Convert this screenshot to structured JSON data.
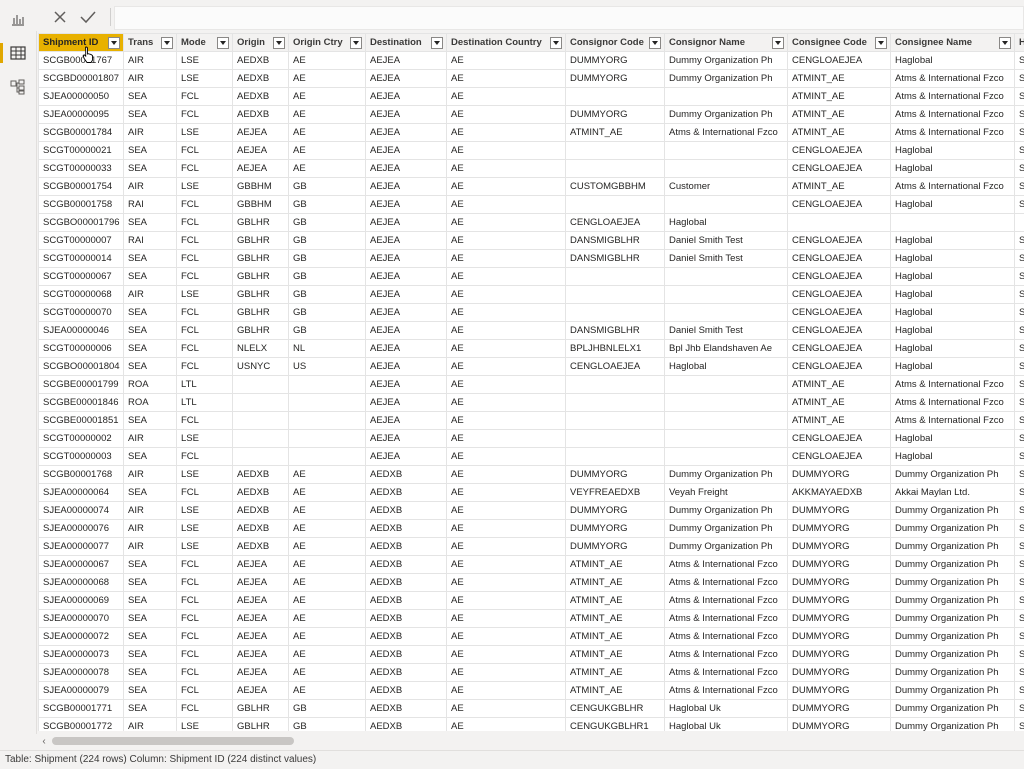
{
  "window": {
    "title": "Power BI Desktop - Data view"
  },
  "sidebar": {
    "items": [
      {
        "name": "report-view",
        "icon": "bar-chart-icon"
      },
      {
        "name": "data-view",
        "icon": "table-icon",
        "active": true
      },
      {
        "name": "model-view",
        "icon": "model-icon"
      }
    ]
  },
  "formula_bar": {
    "cancel_icon": "close-icon",
    "commit_icon": "check-icon",
    "value": ""
  },
  "table": {
    "columns": [
      "Shipment ID",
      "Trans",
      "Mode",
      "Origin",
      "Origin Ctry",
      "Destination",
      "Destination Country",
      "Consignor Code",
      "Consignor Name",
      "Consignee Code",
      "Consignee Name",
      "H"
    ],
    "selected_column": 0,
    "rows": [
      [
        "SCGB00001767",
        "AIR",
        "LSE",
        "AEDXB",
        "AE",
        "AEJEA",
        "AE",
        "DUMMYORG",
        "Dummy Organization Ph",
        "CENGLOAEJEA",
        "Haglobal",
        "SC"
      ],
      [
        "SCGBD00001807",
        "AIR",
        "LSE",
        "AEDXB",
        "AE",
        "AEJEA",
        "AE",
        "DUMMYORG",
        "Dummy Organization Ph",
        "ATMINT_AE",
        "Atms & International Fzco",
        "SC"
      ],
      [
        "SJEA00000050",
        "SEA",
        "FCL",
        "AEDXB",
        "AE",
        "AEJEA",
        "AE",
        "",
        "",
        "ATMINT_AE",
        "Atms & International Fzco",
        "SJ"
      ],
      [
        "SJEA00000095",
        "SEA",
        "FCL",
        "AEDXB",
        "AE",
        "AEJEA",
        "AE",
        "DUMMYORG",
        "Dummy Organization Ph",
        "ATMINT_AE",
        "Atms & International Fzco",
        "SJ"
      ],
      [
        "SCGB00001784",
        "AIR",
        "LSE",
        "AEJEA",
        "AE",
        "AEJEA",
        "AE",
        "ATMINT_AE",
        "Atms & International Fzco",
        "ATMINT_AE",
        "Atms & International Fzco",
        "SC"
      ],
      [
        "SCGT00000021",
        "SEA",
        "FCL",
        "AEJEA",
        "AE",
        "AEJEA",
        "AE",
        "",
        "",
        "CENGLOAEJEA",
        "Haglobal",
        "SC"
      ],
      [
        "SCGT00000033",
        "SEA",
        "FCL",
        "AEJEA",
        "AE",
        "AEJEA",
        "AE",
        "",
        "",
        "CENGLOAEJEA",
        "Haglobal",
        "SC"
      ],
      [
        "SCGB00001754",
        "AIR",
        "LSE",
        "GBBHM",
        "GB",
        "AEJEA",
        "AE",
        "CUSTOMGBBHM",
        "Customer",
        "ATMINT_AE",
        "Atms & International Fzco",
        "SC"
      ],
      [
        "SCGB00001758",
        "RAI",
        "FCL",
        "GBBHM",
        "GB",
        "AEJEA",
        "AE",
        "",
        "",
        "CENGLOAEJEA",
        "Haglobal",
        "SC"
      ],
      [
        "SCGBO00001796",
        "SEA",
        "FCL",
        "GBLHR",
        "GB",
        "AEJEA",
        "AE",
        "CENGLOAEJEA",
        "Haglobal",
        "",
        "",
        ""
      ],
      [
        "SCGT00000007",
        "RAI",
        "FCL",
        "GBLHR",
        "GB",
        "AEJEA",
        "AE",
        "DANSMIGBLHR",
        "Daniel Smith Test",
        "CENGLOAEJEA",
        "Haglobal",
        "SC"
      ],
      [
        "SCGT00000014",
        "SEA",
        "FCL",
        "GBLHR",
        "GB",
        "AEJEA",
        "AE",
        "DANSMIGBLHR",
        "Daniel Smith Test",
        "CENGLOAEJEA",
        "Haglobal",
        "SC"
      ],
      [
        "SCGT00000067",
        "SEA",
        "FCL",
        "GBLHR",
        "GB",
        "AEJEA",
        "AE",
        "",
        "",
        "CENGLOAEJEA",
        "Haglobal",
        "SC"
      ],
      [
        "SCGT00000068",
        "AIR",
        "LSE",
        "GBLHR",
        "GB",
        "AEJEA",
        "AE",
        "",
        "",
        "CENGLOAEJEA",
        "Haglobal",
        "SC"
      ],
      [
        "SCGT00000070",
        "SEA",
        "FCL",
        "GBLHR",
        "GB",
        "AEJEA",
        "AE",
        "",
        "",
        "CENGLOAEJEA",
        "Haglobal",
        "SC"
      ],
      [
        "SJEA00000046",
        "SEA",
        "FCL",
        "GBLHR",
        "GB",
        "AEJEA",
        "AE",
        "DANSMIGBLHR",
        "Daniel Smith Test",
        "CENGLOAEJEA",
        "Haglobal",
        "SJ"
      ],
      [
        "SCGT00000006",
        "SEA",
        "FCL",
        "NLELX",
        "NL",
        "AEJEA",
        "AE",
        "BPLJHBNLELX1",
        "Bpl Jhb Elandshaven Ae",
        "CENGLOAEJEA",
        "Haglobal",
        "SC"
      ],
      [
        "SCGBO00001804",
        "SEA",
        "FCL",
        "USNYC",
        "US",
        "AEJEA",
        "AE",
        "CENGLOAEJEA",
        "Haglobal",
        "CENGLOAEJEA",
        "Haglobal",
        "SC"
      ],
      [
        "SCGBE00001799",
        "ROA",
        "LTL",
        "",
        "",
        "AEJEA",
        "AE",
        "",
        "",
        "ATMINT_AE",
        "Atms & International Fzco",
        "SC"
      ],
      [
        "SCGBE00001846",
        "ROA",
        "LTL",
        "",
        "",
        "AEJEA",
        "AE",
        "",
        "",
        "ATMINT_AE",
        "Atms & International Fzco",
        "SC"
      ],
      [
        "SCGBE00001851",
        "SEA",
        "FCL",
        "",
        "",
        "AEJEA",
        "AE",
        "",
        "",
        "ATMINT_AE",
        "Atms & International Fzco",
        "SC"
      ],
      [
        "SCGT00000002",
        "AIR",
        "LSE",
        "",
        "",
        "AEJEA",
        "AE",
        "",
        "",
        "CENGLOAEJEA",
        "Haglobal",
        "SC"
      ],
      [
        "SCGT00000003",
        "SEA",
        "FCL",
        "",
        "",
        "AEJEA",
        "AE",
        "",
        "",
        "CENGLOAEJEA",
        "Haglobal",
        "SC"
      ],
      [
        "SCGB00001768",
        "AIR",
        "LSE",
        "AEDXB",
        "AE",
        "AEDXB",
        "AE",
        "DUMMYORG",
        "Dummy Organization Ph",
        "DUMMYORG",
        "Dummy Organization Ph",
        "SC"
      ],
      [
        "SJEA00000064",
        "SEA",
        "FCL",
        "AEDXB",
        "AE",
        "AEDXB",
        "AE",
        "VEYFREAEDXB",
        "Veyah Freight",
        "AKKMAYAEDXB",
        "Akkai Maylan Ltd.",
        "SJ"
      ],
      [
        "SJEA00000074",
        "AIR",
        "LSE",
        "AEDXB",
        "AE",
        "AEDXB",
        "AE",
        "DUMMYORG",
        "Dummy Organization Ph",
        "DUMMYORG",
        "Dummy Organization Ph",
        "SJ"
      ],
      [
        "SJEA00000076",
        "AIR",
        "LSE",
        "AEDXB",
        "AE",
        "AEDXB",
        "AE",
        "DUMMYORG",
        "Dummy Organization Ph",
        "DUMMYORG",
        "Dummy Organization Ph",
        "SJ"
      ],
      [
        "SJEA00000077",
        "AIR",
        "LSE",
        "AEDXB",
        "AE",
        "AEDXB",
        "AE",
        "DUMMYORG",
        "Dummy Organization Ph",
        "DUMMYORG",
        "Dummy Organization Ph",
        "SJ"
      ],
      [
        "SJEA00000067",
        "SEA",
        "FCL",
        "AEJEA",
        "AE",
        "AEDXB",
        "AE",
        "ATMINT_AE",
        "Atms & International Fzco",
        "DUMMYORG",
        "Dummy Organization Ph",
        "SJ"
      ],
      [
        "SJEA00000068",
        "SEA",
        "FCL",
        "AEJEA",
        "AE",
        "AEDXB",
        "AE",
        "ATMINT_AE",
        "Atms & International Fzco",
        "DUMMYORG",
        "Dummy Organization Ph",
        "SJ"
      ],
      [
        "SJEA00000069",
        "SEA",
        "FCL",
        "AEJEA",
        "AE",
        "AEDXB",
        "AE",
        "ATMINT_AE",
        "Atms & International Fzco",
        "DUMMYORG",
        "Dummy Organization Ph",
        "SJ"
      ],
      [
        "SJEA00000070",
        "SEA",
        "FCL",
        "AEJEA",
        "AE",
        "AEDXB",
        "AE",
        "ATMINT_AE",
        "Atms & International Fzco",
        "DUMMYORG",
        "Dummy Organization Ph",
        "SJ"
      ],
      [
        "SJEA00000072",
        "SEA",
        "FCL",
        "AEJEA",
        "AE",
        "AEDXB",
        "AE",
        "ATMINT_AE",
        "Atms & International Fzco",
        "DUMMYORG",
        "Dummy Organization Ph",
        "SJ"
      ],
      [
        "SJEA00000073",
        "SEA",
        "FCL",
        "AEJEA",
        "AE",
        "AEDXB",
        "AE",
        "ATMINT_AE",
        "Atms & International Fzco",
        "DUMMYORG",
        "Dummy Organization Ph",
        "SJ"
      ],
      [
        "SJEA00000078",
        "SEA",
        "FCL",
        "AEJEA",
        "AE",
        "AEDXB",
        "AE",
        "ATMINT_AE",
        "Atms & International Fzco",
        "DUMMYORG",
        "Dummy Organization Ph",
        "SJ"
      ],
      [
        "SJEA00000079",
        "SEA",
        "FCL",
        "AEJEA",
        "AE",
        "AEDXB",
        "AE",
        "ATMINT_AE",
        "Atms & International Fzco",
        "DUMMYORG",
        "Dummy Organization Ph",
        "SJ"
      ],
      [
        "SCGB00001771",
        "SEA",
        "FCL",
        "GBLHR",
        "GB",
        "AEDXB",
        "AE",
        "CENGUKGBLHR",
        "Haglobal Uk",
        "DUMMYORG",
        "Dummy Organization Ph",
        "SC"
      ],
      [
        "SCGB00001772",
        "AIR",
        "LSE",
        "GBLHR",
        "GB",
        "AEDXB",
        "AE",
        "CENGUKGBLHR1",
        "Haglobal Uk",
        "DUMMYORG",
        "Dummy Organization Ph",
        "SC"
      ]
    ]
  },
  "status_bar": {
    "text": "Table: Shipment (224 rows) Column: Shipment ID (224 distinct values)"
  },
  "colors": {
    "selected_header": "#e8b100",
    "active_indicator": "#e0a700"
  }
}
